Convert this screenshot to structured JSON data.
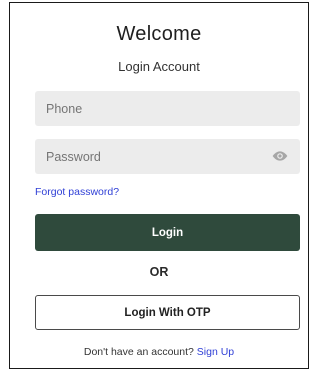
{
  "header": {
    "title": "Welcome",
    "subtitle": "Login Account"
  },
  "form": {
    "phone_placeholder": "Phone",
    "phone_value": "",
    "password_placeholder": "Password",
    "password_value": "",
    "password_toggle_icon": "eye-icon",
    "forgot_label": "Forgot password?",
    "login_label": "Login",
    "divider_label": "OR",
    "otp_label": "Login With OTP"
  },
  "footer": {
    "prompt": "Don't have an account?",
    "signup_label": "Sign Up"
  },
  "colors": {
    "primary": "#2f4a3c",
    "link": "#2f3fd6",
    "field_bg": "#ececec"
  }
}
